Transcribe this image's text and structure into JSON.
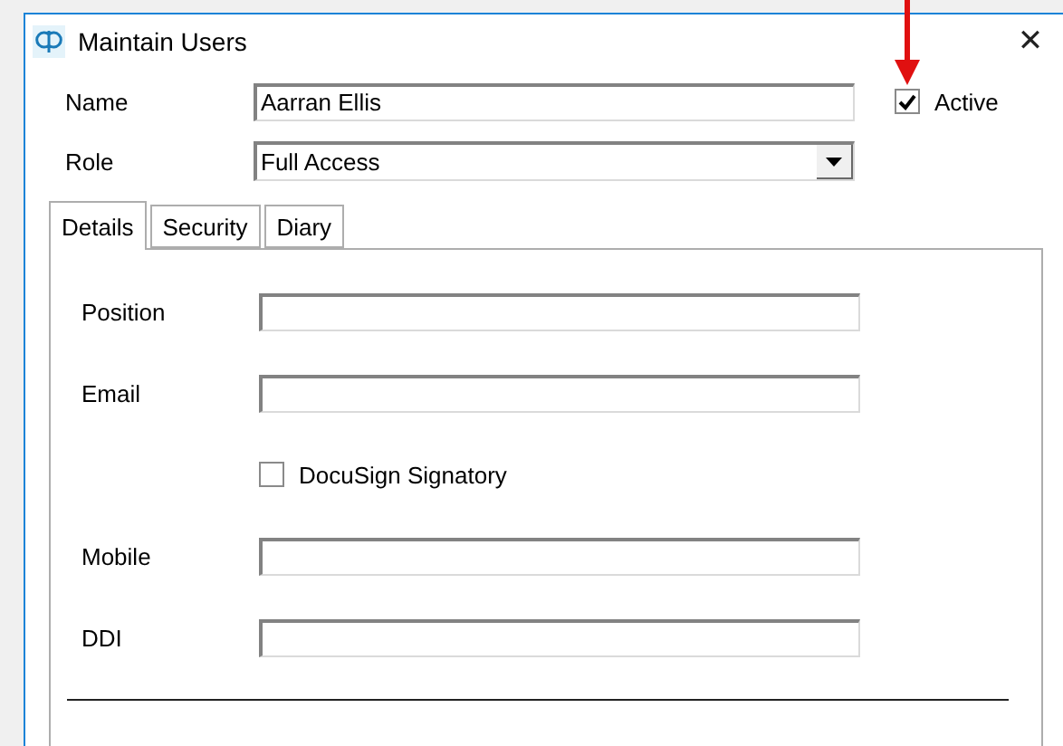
{
  "window": {
    "title": "Maintain Users",
    "close": "✕"
  },
  "name": {
    "label": "Name",
    "value": "Aarran Ellis"
  },
  "active": {
    "label": "Active",
    "checked": true
  },
  "role": {
    "label": "Role",
    "value": "Full Access"
  },
  "tabs": [
    {
      "label": "Details",
      "selected": true
    },
    {
      "label": "Security",
      "selected": false
    },
    {
      "label": "Diary",
      "selected": false
    }
  ],
  "details": [
    {
      "kind": "field",
      "label": "Position"
    },
    {
      "kind": "field",
      "label": "Email"
    },
    {
      "kind": "checkbox",
      "label": "DocuSign Signatory",
      "checked": false
    },
    {
      "kind": "field",
      "label": "Mobile"
    },
    {
      "kind": "field",
      "label": "DDI"
    }
  ]
}
